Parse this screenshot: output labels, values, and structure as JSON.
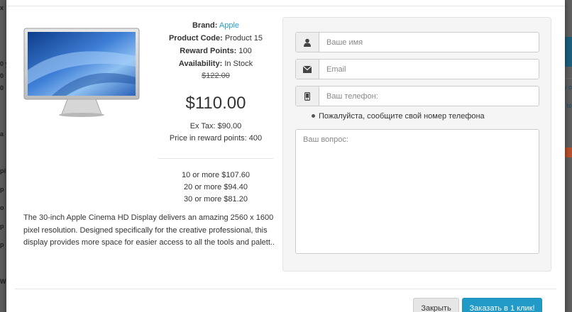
{
  "backdrop": {
    "left_fragments": [
      "x",
      "0 y",
      "0",
      "0",
      "a",
      "pi",
      "p",
      "o",
      "p",
      "p",
      "W"
    ],
    "right_fragments": [
      "y o",
      "te"
    ]
  },
  "product": {
    "brand_label": "Brand:",
    "brand_value": "Apple",
    "code_label": "Product Code:",
    "code_value": "Product 15",
    "reward_label": "Reward Points:",
    "reward_value": "100",
    "availability_label": "Availability:",
    "availability_value": "In Stock",
    "old_price": "$122.00",
    "price": "$110.00",
    "ex_tax": "Ex Tax: $90.00",
    "reward_price": "Price in reward points: 400",
    "discounts": [
      "10 or more $107.60",
      "20 or more $94.40",
      "30 or more $81.20"
    ],
    "description": "The 30-inch Apple Cinema HD Display delivers an amazing 2560 x 1600 pixel resolution. Designed specifically for the creative professional, this display provides more space for easier access to all the tools and palett.."
  },
  "form": {
    "name_placeholder": "Ваше имя",
    "email_placeholder": "Email",
    "phone_placeholder": "Ваш телефон:",
    "phone_hint": "Пожалуйста, сообщите свой номер телефона",
    "question_placeholder": "Ваш вопрос:"
  },
  "buttons": {
    "close": "Закрыть",
    "order": "Заказать в 1 клик!"
  },
  "colors": {
    "link": "#23a1d1",
    "primary": "#229ac8"
  }
}
